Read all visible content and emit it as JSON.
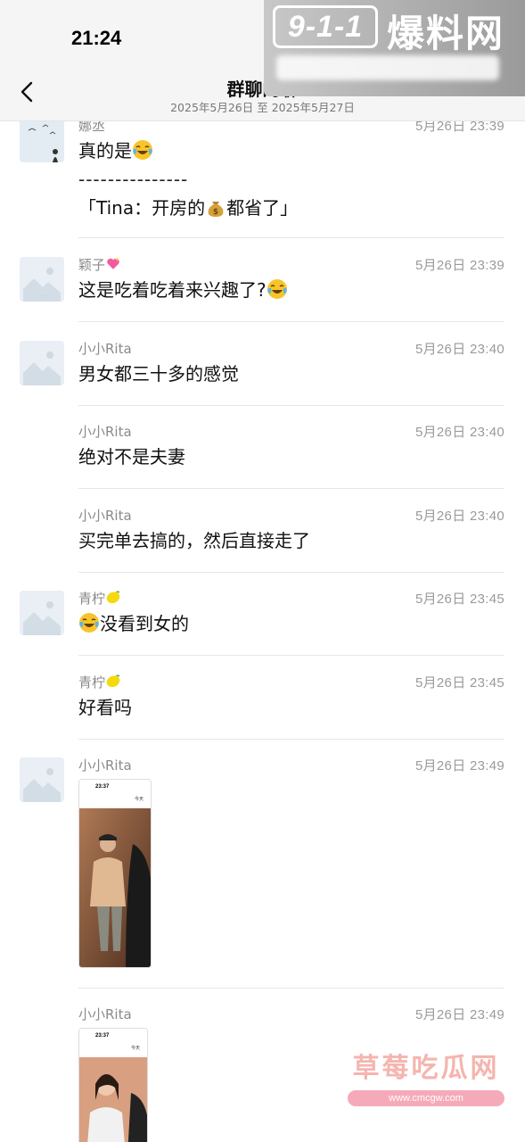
{
  "status_bar": {
    "time": "21:24"
  },
  "header": {
    "title": "群聊的聊",
    "date_range": "2025年5月26日 至 2025年5月27日"
  },
  "watermarks": {
    "top_logo": "9-1-1",
    "top_site": "爆料网",
    "bottom_site": "草莓吃瓜网",
    "bottom_url": "www.cmcgw.com"
  },
  "messages": [
    {
      "sender": "娜丞",
      "time": "5月26日 23:39",
      "text": "真的是",
      "emoji": "laugh-cry-emoji",
      "separator": "---------------",
      "quote_pre": "「Tina：开房的",
      "quote_emoji": "money-bag-emoji",
      "quote_post": "都省了」"
    },
    {
      "sender": "颖子",
      "sender_emoji": "sparkling-heart-emoji",
      "time": "5月26日 23:39",
      "text": "这是吃着吃着来兴趣了?",
      "emoji": "laugh-cry-emoji"
    },
    {
      "sender": "小小Rita",
      "time": "5月26日 23:40",
      "text": "男女都三十多的感觉"
    },
    {
      "sender": "小小Rita",
      "time": "5月26日 23:40",
      "text": "绝对不是夫妻"
    },
    {
      "sender": "小小Rita",
      "time": "5月26日 23:40",
      "text": "买完单去搞的，然后直接走了"
    },
    {
      "sender": "青柠",
      "sender_emoji": "lemon-emoji",
      "time": "5月26日 23:45",
      "text_pre_emoji": "laugh-cry-emoji",
      "text": "没看到女的"
    },
    {
      "sender": "青柠",
      "sender_emoji": "lemon-emoji",
      "time": "5月26日 23:45",
      "text": "好看吗"
    },
    {
      "sender": "小小Rita",
      "time": "5月26日 23:49",
      "photo": {
        "time": "23:37",
        "day": "今天"
      }
    },
    {
      "sender": "小小Rita",
      "time": "5月26日 23:49",
      "photo": {
        "time": "23:37",
        "day": "今天"
      }
    }
  ],
  "colors": {
    "header_bg": "#f5f5f5",
    "meta_text": "#9a9a9a",
    "divider": "#e6e6e6"
  }
}
